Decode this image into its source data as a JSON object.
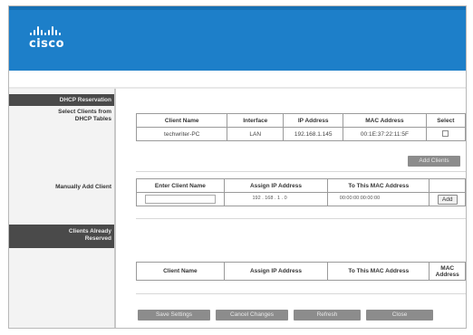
{
  "brand": {
    "name": "cisco",
    "header_color": "#1d7fc9"
  },
  "sidebar": {
    "section_title": "DHCP Reservation",
    "select_clients_label": "Select Clients from DHCP Tables",
    "manually_add_label": "Manually Add Client",
    "already_reserved_label": "Clients Already Reserved"
  },
  "dhcp_table": {
    "headers": [
      "Client Name",
      "Interface",
      "IP Address",
      "MAC Address",
      "Select"
    ],
    "rows": [
      {
        "client_name": "techwriter-PC",
        "interface": "LAN",
        "ip": "192.168.1.145",
        "mac": "00:1E:37:22:11:5F"
      }
    ]
  },
  "add_clients_button": "Add Clients",
  "manual_table": {
    "headers": [
      "Enter Client Name",
      "Assign IP Address",
      "To This MAC Address",
      ""
    ],
    "client_name_value": "",
    "ip_value": "192 . 168 . 1 . 0",
    "mac_value": "00:00:00:00:00:00",
    "add_button": "Add"
  },
  "reserved_table": {
    "headers": [
      "Client Name",
      "Assign IP Address",
      "To This MAC Address",
      "MAC Address"
    ]
  },
  "footer_buttons": {
    "save": "Save Settings",
    "cancel": "Cancel Changes",
    "refresh": "Refresh",
    "close": "Close"
  }
}
